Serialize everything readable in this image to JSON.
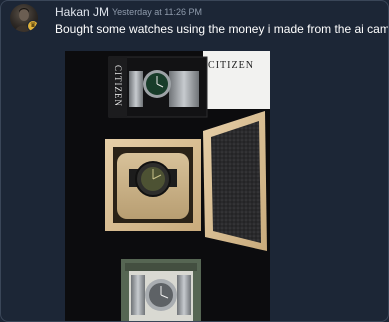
{
  "message": {
    "author": "Hakan JM",
    "timestamp": "Yesterday at 11:26 PM",
    "text": "Bought some watches using the money i made from the ai campus",
    "avatar_badge_icon": "crown-icon"
  },
  "photo": {
    "box_brand_front": "CITIZEN",
    "box_brand_side": "CITIZEN"
  }
}
